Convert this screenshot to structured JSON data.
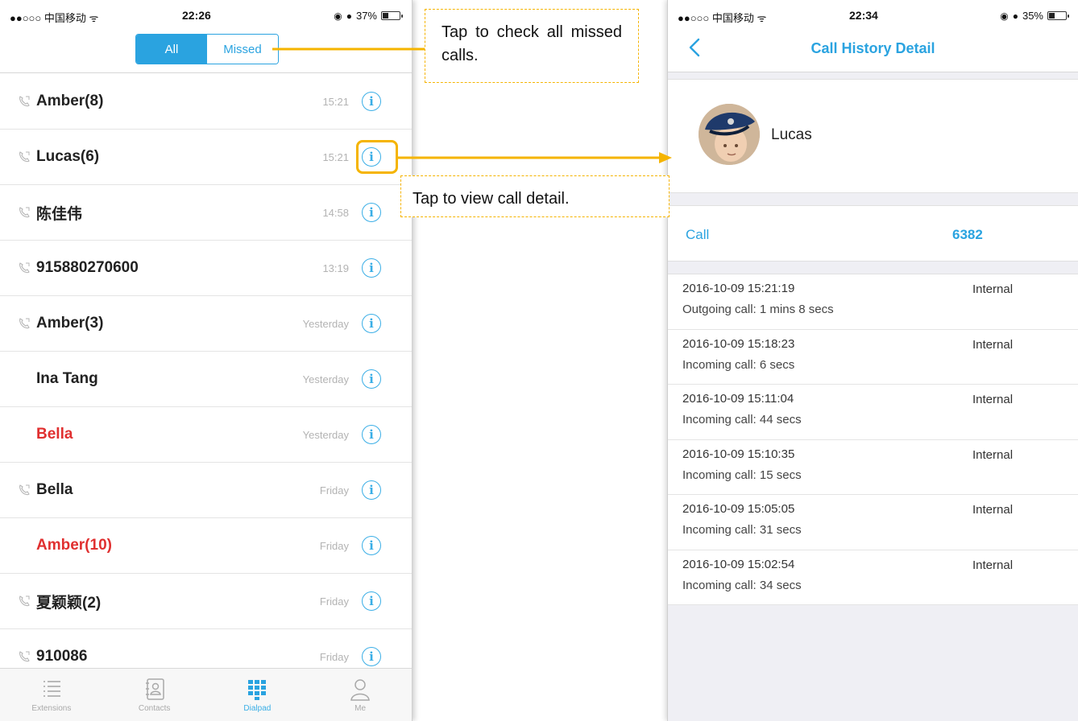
{
  "left_screen": {
    "status": {
      "carrier": "●●○○○ 中国移动 ᯤ",
      "time": "22:26",
      "battery": "37%",
      "battery_level": 0.37
    },
    "segment": {
      "all_label": "All",
      "missed_label": "Missed",
      "selected": "All"
    },
    "calls": [
      {
        "name": "Amber(8)",
        "time": "15:21",
        "show_icon": true,
        "missed": false
      },
      {
        "name": "Lucas(6)",
        "time": "15:21",
        "show_icon": true,
        "missed": false
      },
      {
        "name": "陈佳伟",
        "time": "14:58",
        "show_icon": true,
        "missed": false
      },
      {
        "name": "915880270600",
        "time": "13:19",
        "show_icon": true,
        "missed": false
      },
      {
        "name": "Amber(3)",
        "time": "Yesterday",
        "show_icon": true,
        "missed": false
      },
      {
        "name": "Ina Tang",
        "time": "Yesterday",
        "show_icon": false,
        "missed": false
      },
      {
        "name": "Bella",
        "time": "Yesterday",
        "show_icon": false,
        "missed": true
      },
      {
        "name": "Bella",
        "time": "Friday",
        "show_icon": true,
        "missed": false
      },
      {
        "name": "Amber(10)",
        "time": "Friday",
        "show_icon": false,
        "missed": true
      },
      {
        "name": "夏颖颖(2)",
        "time": "Friday",
        "show_icon": true,
        "missed": false
      },
      {
        "name": "910086",
        "time": "Friday",
        "show_icon": true,
        "missed": false
      }
    ],
    "tabs": [
      {
        "label": "Extensions",
        "icon": "list-icon"
      },
      {
        "label": "Contacts",
        "icon": "contacts-icon"
      },
      {
        "label": "Dialpad",
        "icon": "dialpad-icon"
      },
      {
        "label": "Me",
        "icon": "person-icon"
      }
    ],
    "active_tab": "Dialpad",
    "accent_color": "#2aa3e0",
    "missed_color": "#e03030"
  },
  "right_screen": {
    "status": {
      "carrier": "●●○○○ 中国移动 ᯤ",
      "time": "22:34",
      "battery": "35%",
      "battery_level": 0.35
    },
    "title": "Call History Detail",
    "contact_name": "Lucas",
    "call_label": "Call",
    "call_number": "6382",
    "history": [
      {
        "datetime": "2016-10-09 15:21:19",
        "type": "Internal",
        "desc": "Outgoing call:  1 mins 8 secs"
      },
      {
        "datetime": "2016-10-09 15:18:23",
        "type": "Internal",
        "desc": "Incoming call:  6 secs"
      },
      {
        "datetime": "2016-10-09 15:11:04",
        "type": "Internal",
        "desc": "Incoming call:  44 secs"
      },
      {
        "datetime": "2016-10-09 15:10:35",
        "type": "Internal",
        "desc": "Incoming call:  15 secs"
      },
      {
        "datetime": "2016-10-09 15:05:05",
        "type": "Internal",
        "desc": "Incoming call:  31 secs"
      },
      {
        "datetime": "2016-10-09 15:02:54",
        "type": "Internal",
        "desc": "Incoming call:  34 secs"
      }
    ]
  },
  "annotations": {
    "missed_note": "Tap to check all missed calls.",
    "detail_note": "Tap to view call detail.",
    "highlight_color": "#f5b400"
  }
}
